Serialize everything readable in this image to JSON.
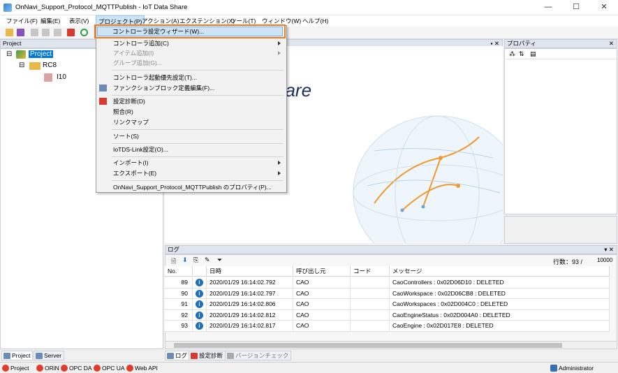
{
  "window": {
    "title": "OnNavi_Support_Protocol_MQTTPublish - IoT Data Share",
    "minimize": "—",
    "maximize": "☐",
    "close": "✕"
  },
  "menubar": {
    "file": "ファイル(F)",
    "edit": "編集(E)",
    "view": "表示(V)",
    "project": "プロジェクト(P)",
    "action": "アクション(A)",
    "extension": "エクステンション(X)",
    "tools": "ツール(T)",
    "window": "ウィンドウ(W)",
    "help": "ヘルプ(H)"
  },
  "project_panel": {
    "title": "Project",
    "root": "Project",
    "controller": "RC8",
    "item": "I10",
    "tabs": [
      "Project",
      "Server"
    ]
  },
  "document": {
    "logo_text": "hare"
  },
  "properties_panel": {
    "title": "プロパティ"
  },
  "project_menu": {
    "items": [
      "コントローラ設定ウィザード(W)...",
      "コントローラ追加(C)",
      "アイテム追加(I)",
      "グループ追加(G)...",
      "コントローラ起動優先設定(T)...",
      "ファンクションブロック定義編集(F)...",
      "設定診断(D)",
      "照合(R)",
      "リンクマップ",
      "ソート(S)",
      "IoTDS-Link設定(O)...",
      "インポート(I)",
      "エクスポート(E)",
      "OnNavi_Support_Protocol_MQTTPublish のプロパティ(P)..."
    ]
  },
  "log_panel": {
    "title": "ログ",
    "row_count_label": "行数：93 /",
    "max_rows": "10000",
    "columns": [
      "No.",
      "",
      "日時",
      "呼び出し元",
      "コード",
      "メッセージ"
    ],
    "rows": [
      {
        "no": "89",
        "datetime": "2020/01/29 16:14:02.792",
        "caller": "CAO",
        "code": "",
        "message": "CaoControllers : 0x02D06D10 : DELETED"
      },
      {
        "no": "90",
        "datetime": "2020/01/29 16:14:02.797",
        "caller": "CAO",
        "code": "",
        "message": "CaoWorkspace : 0x02D06CB8 : DELETED"
      },
      {
        "no": "91",
        "datetime": "2020/01/29 16:14:02.806",
        "caller": "CAO",
        "code": "",
        "message": "CaoWorkspaces : 0x02D004C0 : DELETED"
      },
      {
        "no": "92",
        "datetime": "2020/01/29 16:14:02.812",
        "caller": "CAO",
        "code": "",
        "message": "CaoEngineStatus : 0x02D004A0 : DELETED"
      },
      {
        "no": "93",
        "datetime": "2020/01/29 16:14:02.817",
        "caller": "CAO",
        "code": "",
        "message": "CaoEngine : 0x02D017E8 : DELETED"
      }
    ],
    "tabs": [
      "ログ",
      "設定診断",
      "バージョンチェック"
    ]
  },
  "statusbar": {
    "items": [
      "Project",
      "ORiN",
      "OPC DA",
      "OPC UA",
      "Web API"
    ],
    "user": "Administrator"
  },
  "colors": {
    "accent": "#0078d7",
    "highlight_border": "#f47a20",
    "status_dot": "#e23b2e"
  }
}
